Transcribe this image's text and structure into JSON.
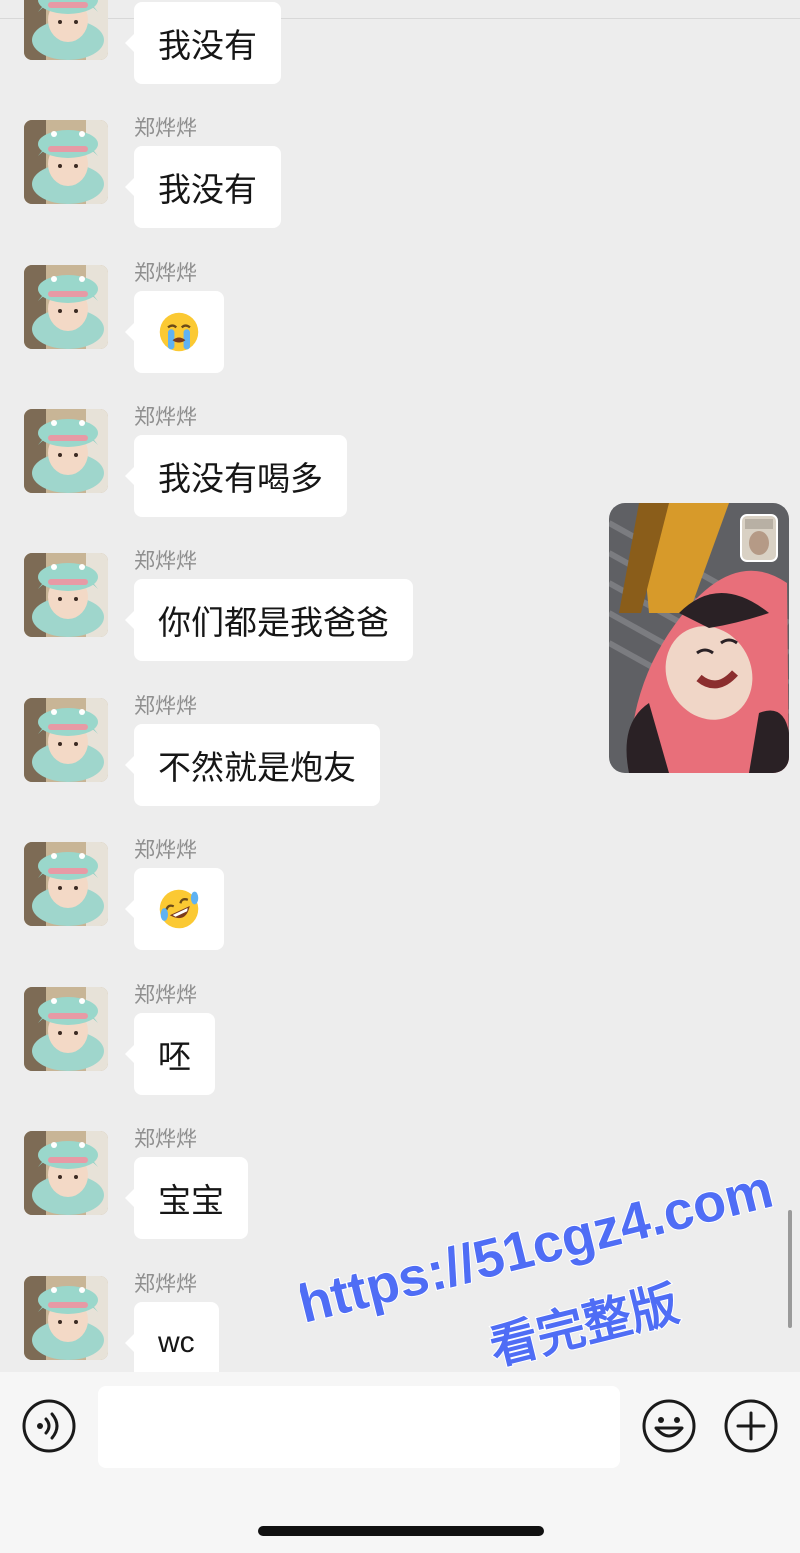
{
  "sender_name": "郑烨烨",
  "messages": [
    {
      "text": "我没有",
      "type": "text"
    },
    {
      "text": "我没有",
      "type": "text"
    },
    {
      "text": "",
      "type": "emoji",
      "emoji_name": "loudly-crying-face-icon"
    },
    {
      "text": "我没有喝多",
      "type": "text"
    },
    {
      "text": "你们都是我爸爸",
      "type": "text"
    },
    {
      "text": "不然就是炮友",
      "type": "text"
    },
    {
      "text": "",
      "type": "emoji",
      "emoji_name": "rolling-on-floor-laughing-icon"
    },
    {
      "text": "呸",
      "type": "text"
    },
    {
      "text": "宝宝",
      "type": "text"
    },
    {
      "text": "wc",
      "type": "text"
    }
  ],
  "watermark": {
    "line1": "https://51cgz4.com",
    "line2": "看完整版",
    "color": "#4f6df5"
  },
  "input_bar": {
    "placeholder": "",
    "voice_icon": "voice-icon",
    "emoji_icon": "smiley-icon",
    "plus_icon": "plus-icon"
  },
  "colors": {
    "background": "#ededed",
    "bubble": "#ffffff",
    "sender_name": "#8f8f8f",
    "input_bar": "#f6f6f6"
  }
}
